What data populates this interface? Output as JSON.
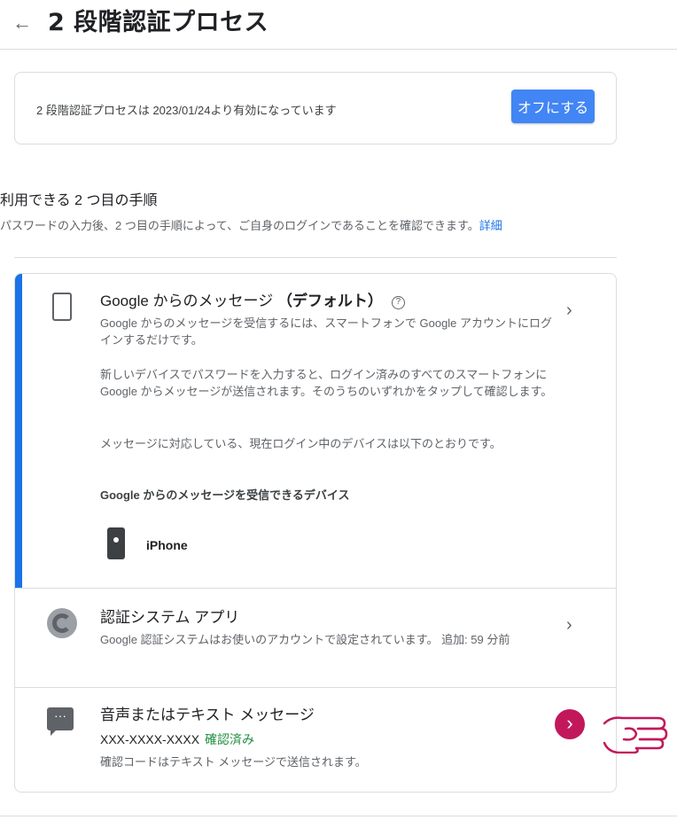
{
  "header": {
    "back_icon": "arrow-left-icon",
    "title": "2 段階認証プロセス"
  },
  "status": {
    "text": "2 段階認証プロセスは 2023/01/24より有効になっています",
    "off_button": "オフにする"
  },
  "section": {
    "heading": "利用できる 2 つ目の手順",
    "subtitle": "パスワードの入力後、2 つ目の手順によって、ご自身のログインであることを確認できます。",
    "link": "詳細"
  },
  "methods": [
    {
      "icon": "smartphone-icon",
      "title": "Google からのメッセージ",
      "title_bold": "（デフォルト）",
      "desc1": "Google からのメッセージを受信するには、スマートフォンで Google アカウントにログインするだけです。",
      "desc2": "新しいデバイスでパスワードを入力すると、ログイン済みのすべてのスマートフォンに Google からメッセージが送信されます。そのうちのいずれかをタップして確認します。",
      "desc3": "メッセージに対応している、現在ログイン中のデバイスは以下のとおりです。",
      "devices_heading": "Google からのメッセージを受信できるデバイス",
      "device": "iPhone"
    },
    {
      "icon": "authenticator-icon",
      "title": "認証システム アプリ",
      "desc": "Google 認証システムはお使いのアカウントで設定されています。 追加: 59 分前"
    },
    {
      "icon": "sms-icon",
      "title": "音声またはテキスト メッセージ",
      "phone": "XXX-XXXX-XXXX",
      "verified": "確認済み",
      "desc": "確認コードはテキスト メッセージで送信されます。"
    }
  ],
  "colors": {
    "accent": "#1a73e8",
    "button": "#4285f4",
    "verified": "#1e8e3e",
    "highlight": "#c2185b"
  }
}
